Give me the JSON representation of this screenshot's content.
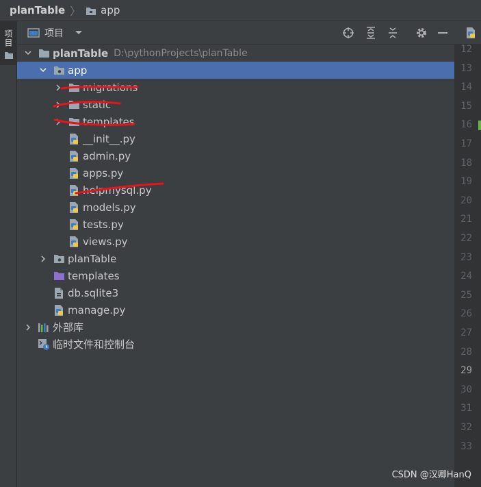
{
  "breadcrumb": {
    "root": "planTable",
    "leaf": "app"
  },
  "side_strip": {
    "label": "项目"
  },
  "panel": {
    "title": "项目"
  },
  "tree": [
    {
      "name": "planTable",
      "path": "D:\\pythonProjects\\planTable",
      "bold": true
    },
    {
      "name": "app"
    },
    {
      "name": "migrations"
    },
    {
      "name": "static"
    },
    {
      "name": "templates"
    },
    {
      "name": "__init__.py"
    },
    {
      "name": "admin.py"
    },
    {
      "name": "apps.py"
    },
    {
      "name": "helpmysql.py"
    },
    {
      "name": "models.py"
    },
    {
      "name": "tests.py"
    },
    {
      "name": "views.py"
    },
    {
      "name": "planTable"
    },
    {
      "name": "templates"
    },
    {
      "name": "db.sqlite3"
    },
    {
      "name": "manage.py"
    },
    {
      "name": "外部库"
    },
    {
      "name": "临时文件和控制台"
    }
  ],
  "line_numbers": [
    "12",
    "13",
    "14",
    "15",
    "16",
    "17",
    "18",
    "19",
    "20",
    "21",
    "22",
    "23",
    "24",
    "25",
    "26",
    "27",
    "28",
    "29",
    "30",
    "31",
    "32",
    "33"
  ],
  "current_line": "29",
  "watermark": "CSDN @汉卿HanQ",
  "colors": {
    "selection": "#4b6eaf",
    "scribble": "#e8141b",
    "python_blue": "#3f7cc0",
    "python_yellow": "#f2c744",
    "template_folder": "#8c6fd1"
  }
}
